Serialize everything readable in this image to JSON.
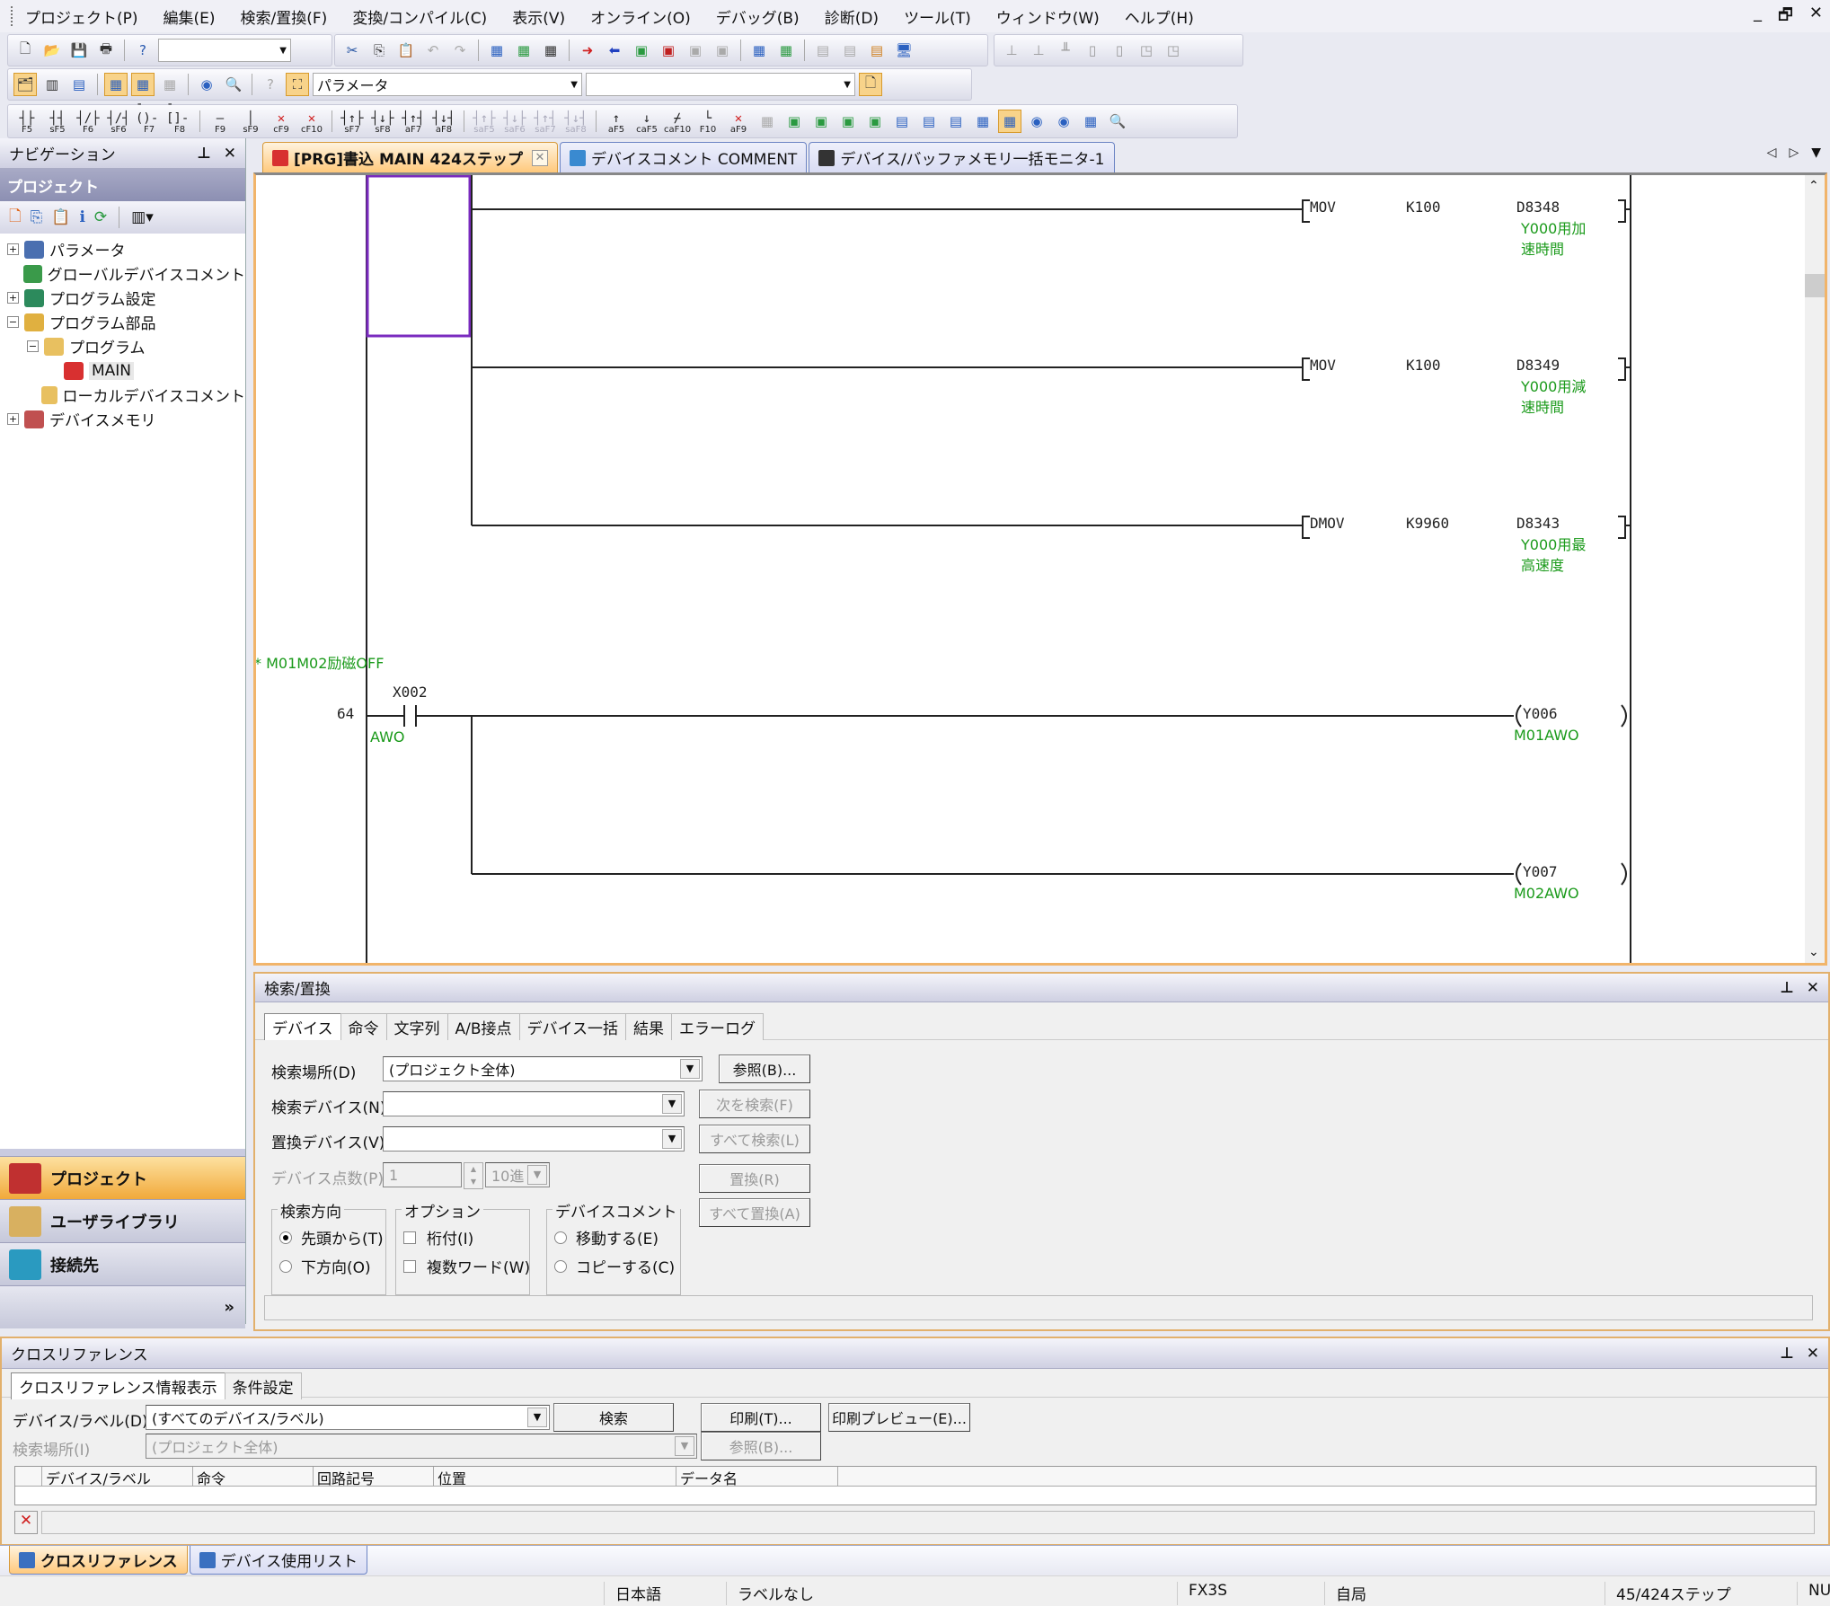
{
  "menu": [
    "プロジェクト(P)",
    "編集(E)",
    "検索/置換(F)",
    "変換/コンパイル(C)",
    "表示(V)",
    "オンライン(O)",
    "デバッグ(B)",
    "診断(D)",
    "ツール(T)",
    "ウィンドウ(W)",
    "ヘルプ(H)"
  ],
  "window_controls": {
    "minimize": "_",
    "restore": "🗗",
    "close": "✕"
  },
  "toolbar": {
    "combo1_value": "",
    "combo2_value": "パラメータ",
    "combo3_value": "",
    "fkeys": [
      {
        "sym": "┤├",
        "key": "F5",
        "enabled": true
      },
      {
        "sym": "┤┤",
        "key": "sF5",
        "enabled": true
      },
      {
        "sym": "┤/├",
        "key": "F6",
        "enabled": true
      },
      {
        "sym": "┤/┤",
        "key": "sF6",
        "enabled": true
      },
      {
        "sym": "-()-",
        "key": "F7",
        "enabled": true
      },
      {
        "sym": "-[]-",
        "key": "F8",
        "enabled": true
      },
      {
        "sym": "—",
        "key": "F9",
        "enabled": true
      },
      {
        "sym": "│",
        "key": "sF9",
        "enabled": true
      },
      {
        "sym": "✕",
        "key": "cF9",
        "enabled": true
      },
      {
        "sym": "✕",
        "key": "cF10",
        "enabled": true
      },
      {
        "sym": "┤↑├",
        "key": "sF7",
        "enabled": true
      },
      {
        "sym": "┤↓├",
        "key": "sF8",
        "enabled": true
      },
      {
        "sym": "┤↑┤",
        "key": "aF7",
        "enabled": true
      },
      {
        "sym": "┤↓┤",
        "key": "aF8",
        "enabled": true
      },
      {
        "sym": "┤↑├",
        "key": "saF5",
        "enabled": false
      },
      {
        "sym": "┤↓├",
        "key": "saF6",
        "enabled": false
      },
      {
        "sym": "┤↑┤",
        "key": "saF7",
        "enabled": false
      },
      {
        "sym": "┤↓┤",
        "key": "saF8",
        "enabled": false
      },
      {
        "sym": "↑",
        "key": "aF5",
        "enabled": true
      },
      {
        "sym": "↓",
        "key": "caF5",
        "enabled": true
      },
      {
        "sym": "⌿",
        "key": "caF10",
        "enabled": true
      },
      {
        "sym": "└",
        "key": "F10",
        "enabled": true
      },
      {
        "sym": "✕",
        "key": "aF9",
        "enabled": true
      }
    ]
  },
  "navigation": {
    "title": "ナビゲーション",
    "section": "プロジェクト",
    "tree": [
      {
        "label": "パラメータ",
        "expander": "+",
        "depth": 0,
        "color": "#4a6fb0"
      },
      {
        "label": "グローバルデバイスコメント",
        "expander": "",
        "depth": 0,
        "color": "#3a9a4a"
      },
      {
        "label": "プログラム設定",
        "expander": "+",
        "depth": 0,
        "color": "#2c8a5c"
      },
      {
        "label": "プログラム部品",
        "expander": "−",
        "depth": 0,
        "color": "#e0b040"
      },
      {
        "label": "プログラム",
        "expander": "−",
        "depth": 1,
        "color": "#e8c060"
      },
      {
        "label": "MAIN",
        "expander": "",
        "depth": 2,
        "color": "#d83030",
        "selected": true
      },
      {
        "label": "ローカルデバイスコメント",
        "expander": "",
        "depth": 1,
        "color": "#e8c060"
      },
      {
        "label": "デバイスメモリ",
        "expander": "+",
        "depth": 0,
        "color": "#c05050"
      }
    ],
    "bottom_buttons": [
      {
        "label": "プロジェクト",
        "active": true
      },
      {
        "label": "ユーザライブラリ",
        "active": false
      },
      {
        "label": "接続先",
        "active": false
      }
    ],
    "more": "»"
  },
  "doc_tabs": [
    {
      "label": "[PRG]書込 MAIN 424ステップ",
      "active": true,
      "closable": true,
      "icon_color": "#d83030"
    },
    {
      "label": "デバイスコメント COMMENT",
      "active": false,
      "closable": false,
      "icon_color": "#3a8ad0"
    },
    {
      "label": "デバイス/バッファメモリ一括モニタ-1",
      "active": false,
      "closable": false,
      "icon_color": "#333"
    }
  ],
  "ladder": {
    "instructions": [
      {
        "op": "MOV",
        "src": "K100",
        "dst": "D8348",
        "comment": [
          "Y000用加",
          "速時間"
        ]
      },
      {
        "op": "MOV",
        "src": "K100",
        "dst": "D8349",
        "comment": [
          "Y000用減",
          "速時間"
        ]
      },
      {
        "op": "DMOV",
        "src": "K9960",
        "dst": "D8343",
        "comment": [
          "Y000用最",
          "高速度"
        ]
      }
    ],
    "statement": "* M01M02励磁OFF",
    "step": "64",
    "contact": {
      "device": "X002",
      "comment": "AWO"
    },
    "coils": [
      {
        "device": "Y006",
        "comment": "M01AWO"
      },
      {
        "device": "Y007",
        "comment": "M02AWO"
      }
    ]
  },
  "search": {
    "title": "検索/置換",
    "tabs": [
      "デバイス",
      "命令",
      "文字列",
      "A/B接点",
      "デバイス一括",
      "結果",
      "エラーログ"
    ],
    "active_tab": 0,
    "fields": {
      "location_label": "検索場所(D)",
      "location_value": "(プロジェクト全体)",
      "device_label": "検索デバイス(N)",
      "device_value": "",
      "replace_label": "置換デバイス(V)",
      "replace_value": "",
      "count_label": "デバイス点数(P)",
      "count_value": "1",
      "radix_value": "10進"
    },
    "buttons": {
      "browse": "参照(B)...",
      "find_next": "次を検索(F)",
      "find_all": "すべて検索(L)",
      "replace": "置換(R)",
      "replace_all": "すべて置換(A)"
    },
    "direction": {
      "title": "検索方向",
      "options": [
        "先頭から(T)",
        "下方向(O)"
      ],
      "selected": 0
    },
    "options": {
      "title": "オプション",
      "items": [
        "桁付(I)",
        "複数ワード(W)"
      ]
    },
    "comment": {
      "title": "デバイスコメント",
      "options": [
        "移動する(E)",
        "コピーする(C)"
      ]
    }
  },
  "xref": {
    "title": "クロスリファレンス",
    "tabs": [
      "クロスリファレンス情報表示",
      "条件設定"
    ],
    "device_label": "デバイス/ラベル(D)",
    "device_value": "(すべてのデバイス/ラベル)",
    "location_label": "検索場所(I)",
    "location_value": "(プロジェクト全体)",
    "buttons": {
      "search": "検索",
      "print": "印刷(T)...",
      "preview": "印刷プレビュー(E)...",
      "browse": "参照(B)..."
    },
    "columns": [
      "デバイス/ラベル",
      "命令",
      "回路記号",
      "位置",
      "データ名"
    ]
  },
  "bottom_tabs": [
    {
      "label": "クロスリファレンス",
      "active": true
    },
    {
      "label": "デバイス使用リスト",
      "active": false
    }
  ],
  "status": {
    "language": "日本語",
    "label": "ラベルなし",
    "cpu": "FX3S",
    "station": "自局",
    "steps": "45/424ステップ",
    "mode": "NUM"
  }
}
